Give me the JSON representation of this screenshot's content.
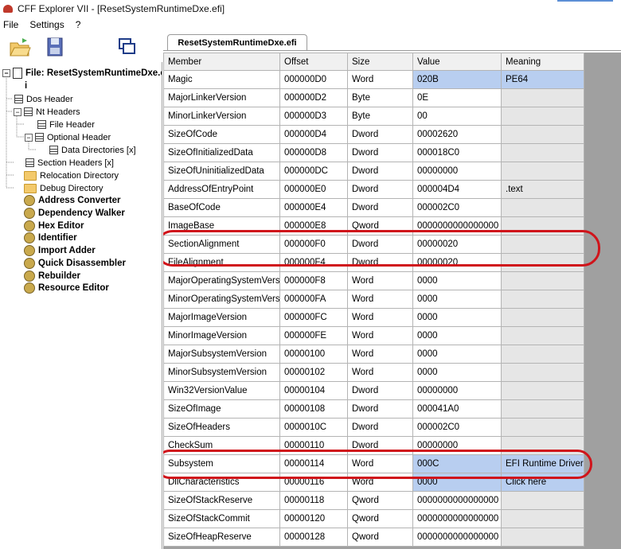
{
  "window": {
    "title": "CFF Explorer VII - [ResetSystemRuntimeDxe.efi]"
  },
  "menu": [
    "File",
    "Settings",
    "?"
  ],
  "toolbar": {
    "icons": [
      "open-folder-icon",
      "save-disk-icon",
      "windows-icon"
    ]
  },
  "tree": {
    "root": {
      "label": "File: ResetSystemRuntimeDxe.efi",
      "label_cont": "i"
    },
    "items": [
      {
        "label": "Dos Header"
      },
      {
        "label": "Nt Headers"
      },
      {
        "label": "File Header"
      },
      {
        "label": "Optional Header"
      },
      {
        "label": "Data Directories [x]"
      },
      {
        "label": "Section Headers [x]"
      },
      {
        "label": "Relocation Directory"
      },
      {
        "label": "Debug Directory"
      }
    ],
    "tools": [
      "Address Converter",
      "Dependency Walker",
      "Hex Editor",
      "Identifier",
      "Import Adder",
      "Quick Disassembler",
      "Rebuilder",
      "Resource Editor"
    ]
  },
  "tab": {
    "label": "ResetSystemRuntimeDxe.efi"
  },
  "grid": {
    "columns": [
      "Member",
      "Offset",
      "Size",
      "Value",
      "Meaning"
    ],
    "rows": [
      [
        "Magic",
        "000000D0",
        "Word",
        "020B",
        "PE64"
      ],
      [
        "MajorLinkerVersion",
        "000000D2",
        "Byte",
        "0E",
        ""
      ],
      [
        "MinorLinkerVersion",
        "000000D3",
        "Byte",
        "00",
        ""
      ],
      [
        "SizeOfCode",
        "000000D4",
        "Dword",
        "00002620",
        ""
      ],
      [
        "SizeOfInitializedData",
        "000000D8",
        "Dword",
        "000018C0",
        ""
      ],
      [
        "SizeOfUninitializedData",
        "000000DC",
        "Dword",
        "00000000",
        ""
      ],
      [
        "AddressOfEntryPoint",
        "000000E0",
        "Dword",
        "000004D4",
        ".text"
      ],
      [
        "BaseOfCode",
        "000000E4",
        "Dword",
        "000002C0",
        ""
      ],
      [
        "ImageBase",
        "000000E8",
        "Qword",
        "0000000000000000",
        ""
      ],
      [
        "SectionAlignment",
        "000000F0",
        "Dword",
        "00000020",
        ""
      ],
      [
        "FileAlignment",
        "000000F4",
        "Dword",
        "00000020",
        ""
      ],
      [
        "MajorOperatingSystemVers...",
        "000000F8",
        "Word",
        "0000",
        ""
      ],
      [
        "MinorOperatingSystemVers...",
        "000000FA",
        "Word",
        "0000",
        ""
      ],
      [
        "MajorImageVersion",
        "000000FC",
        "Word",
        "0000",
        ""
      ],
      [
        "MinorImageVersion",
        "000000FE",
        "Word",
        "0000",
        ""
      ],
      [
        "MajorSubsystemVersion",
        "00000100",
        "Word",
        "0000",
        ""
      ],
      [
        "MinorSubsystemVersion",
        "00000102",
        "Word",
        "0000",
        ""
      ],
      [
        "Win32VersionValue",
        "00000104",
        "Dword",
        "00000000",
        ""
      ],
      [
        "SizeOfImage",
        "00000108",
        "Dword",
        "000041A0",
        ""
      ],
      [
        "SizeOfHeaders",
        "0000010C",
        "Dword",
        "000002C0",
        ""
      ],
      [
        "CheckSum",
        "00000110",
        "Dword",
        "00000000",
        ""
      ],
      [
        "Subsystem",
        "00000114",
        "Word",
        "000C",
        "EFI Runtime Driver"
      ],
      [
        "DllCharacteristics",
        "00000116",
        "Word",
        "0000",
        "Click here"
      ],
      [
        "SizeOfStackReserve",
        "00000118",
        "Qword",
        "0000000000000000",
        ""
      ],
      [
        "SizeOfStackCommit",
        "00000120",
        "Qword",
        "0000000000000000",
        ""
      ],
      [
        "SizeOfHeapReserve",
        "00000128",
        "Qword",
        "0000000000000000",
        ""
      ]
    ],
    "highlighted_rows": [
      0,
      21,
      22
    ]
  },
  "colors": {
    "highlight": "#b8cef0",
    "annotation": "#d0141b"
  }
}
